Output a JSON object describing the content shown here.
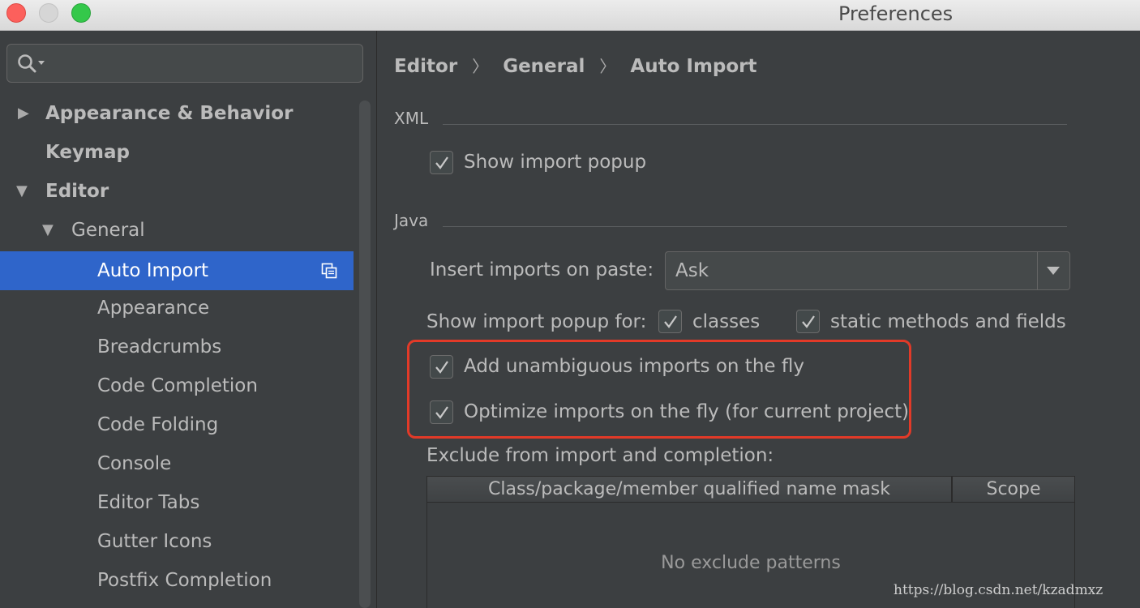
{
  "window": {
    "title": "Preferences"
  },
  "sidebar": {
    "items": [
      {
        "label": "Appearance & Behavior"
      },
      {
        "label": "Keymap"
      },
      {
        "label": "Editor"
      },
      {
        "label": "General"
      },
      {
        "label": "Auto Import"
      },
      {
        "label": "Appearance"
      },
      {
        "label": "Breadcrumbs"
      },
      {
        "label": "Code Completion"
      },
      {
        "label": "Code Folding"
      },
      {
        "label": "Console"
      },
      {
        "label": "Editor Tabs"
      },
      {
        "label": "Gutter Icons"
      },
      {
        "label": "Postfix Completion"
      }
    ],
    "selected": "Auto Import"
  },
  "breadcrumb": [
    "Editor",
    "General",
    "Auto Import"
  ],
  "xml": {
    "title": "XML",
    "show_import_popup": {
      "label": "Show import popup",
      "checked": true
    }
  },
  "java": {
    "title": "Java",
    "insert_imports_label": "Insert imports on paste:",
    "insert_imports_value": "Ask",
    "show_popup_for_label": "Show import popup for:",
    "classes": {
      "label": "classes",
      "checked": true
    },
    "static_methods": {
      "label": "static methods and fields",
      "checked": true
    },
    "add_unambiguous": {
      "label": "Add unambiguous imports on the fly",
      "checked": true
    },
    "optimize_imports": {
      "label": "Optimize imports on the fly (for current project)",
      "checked": true
    },
    "exclude_label": "Exclude from import and completion:",
    "table": {
      "columns": [
        "Class/package/member qualified name mask",
        "Scope"
      ],
      "empty_text": "No exclude patterns"
    }
  },
  "watermark": "https://blog.csdn.net/kzadmxz",
  "colors": {
    "selection": "#2f65ca",
    "highlight_border": "#e23a28"
  }
}
